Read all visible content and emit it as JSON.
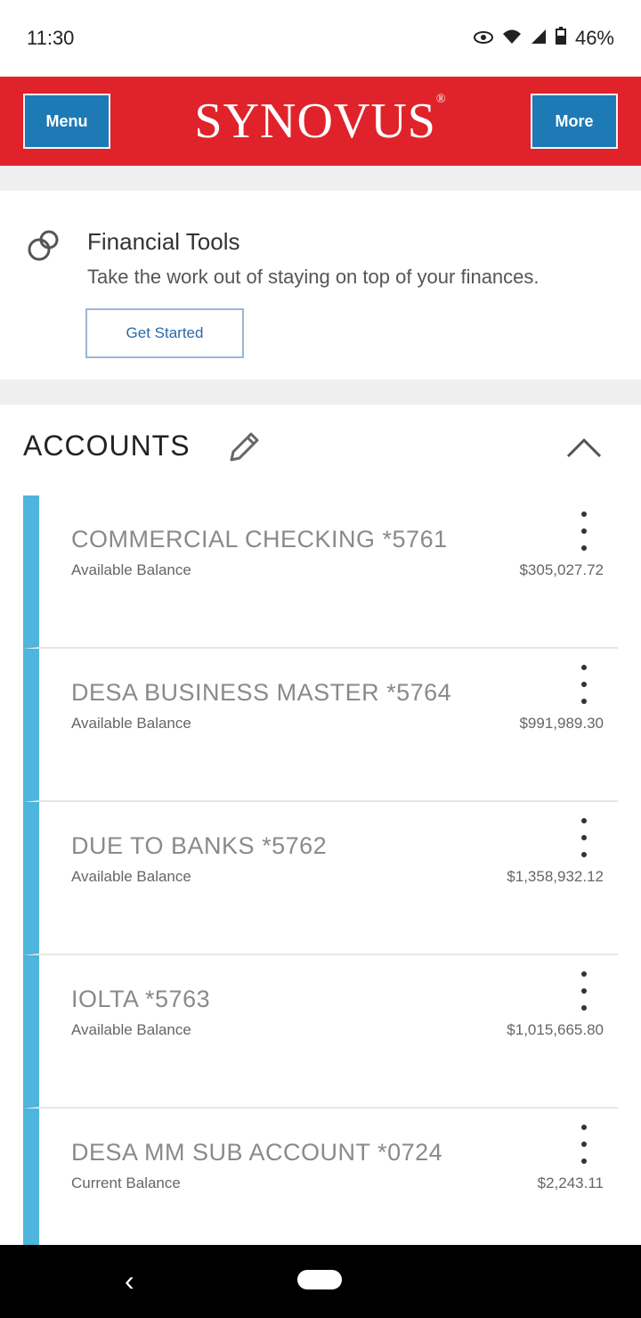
{
  "status_bar": {
    "time": "11:30",
    "battery": "46%"
  },
  "header": {
    "menu_label": "Menu",
    "brand": "SYNOVUS",
    "more_label": "More"
  },
  "financial_tools": {
    "title": "Financial Tools",
    "subtitle": "Take the work out of staying on top of your finances.",
    "button_label": "Get Started"
  },
  "accounts_section": {
    "title": "ACCOUNTS",
    "items": [
      {
        "name": "COMMERCIAL CHECKING *5761",
        "balance_label": "Available Balance",
        "balance": "$305,027.72"
      },
      {
        "name": "DESA BUSINESS MASTER *5764",
        "balance_label": "Available Balance",
        "balance": "$991,989.30"
      },
      {
        "name": "DUE TO BANKS *5762",
        "balance_label": "Available Balance",
        "balance": "$1,358,932.12"
      },
      {
        "name": "IOLTA *5763",
        "balance_label": "Available Balance",
        "balance": "$1,015,665.80"
      },
      {
        "name": "DESA MM SUB ACCOUNT *0724",
        "balance_label": "Current Balance",
        "balance": "$2,243.11"
      }
    ]
  },
  "icons": {
    "tools": "coins-icon",
    "edit": "pencil-icon",
    "collapse": "chevron-up-icon",
    "row_menu": "kebab-menu-icon"
  },
  "colors": {
    "brand_red": "#e0232a",
    "button_blue": "#1d7ab5",
    "account_accent": "#4eb6dd"
  }
}
